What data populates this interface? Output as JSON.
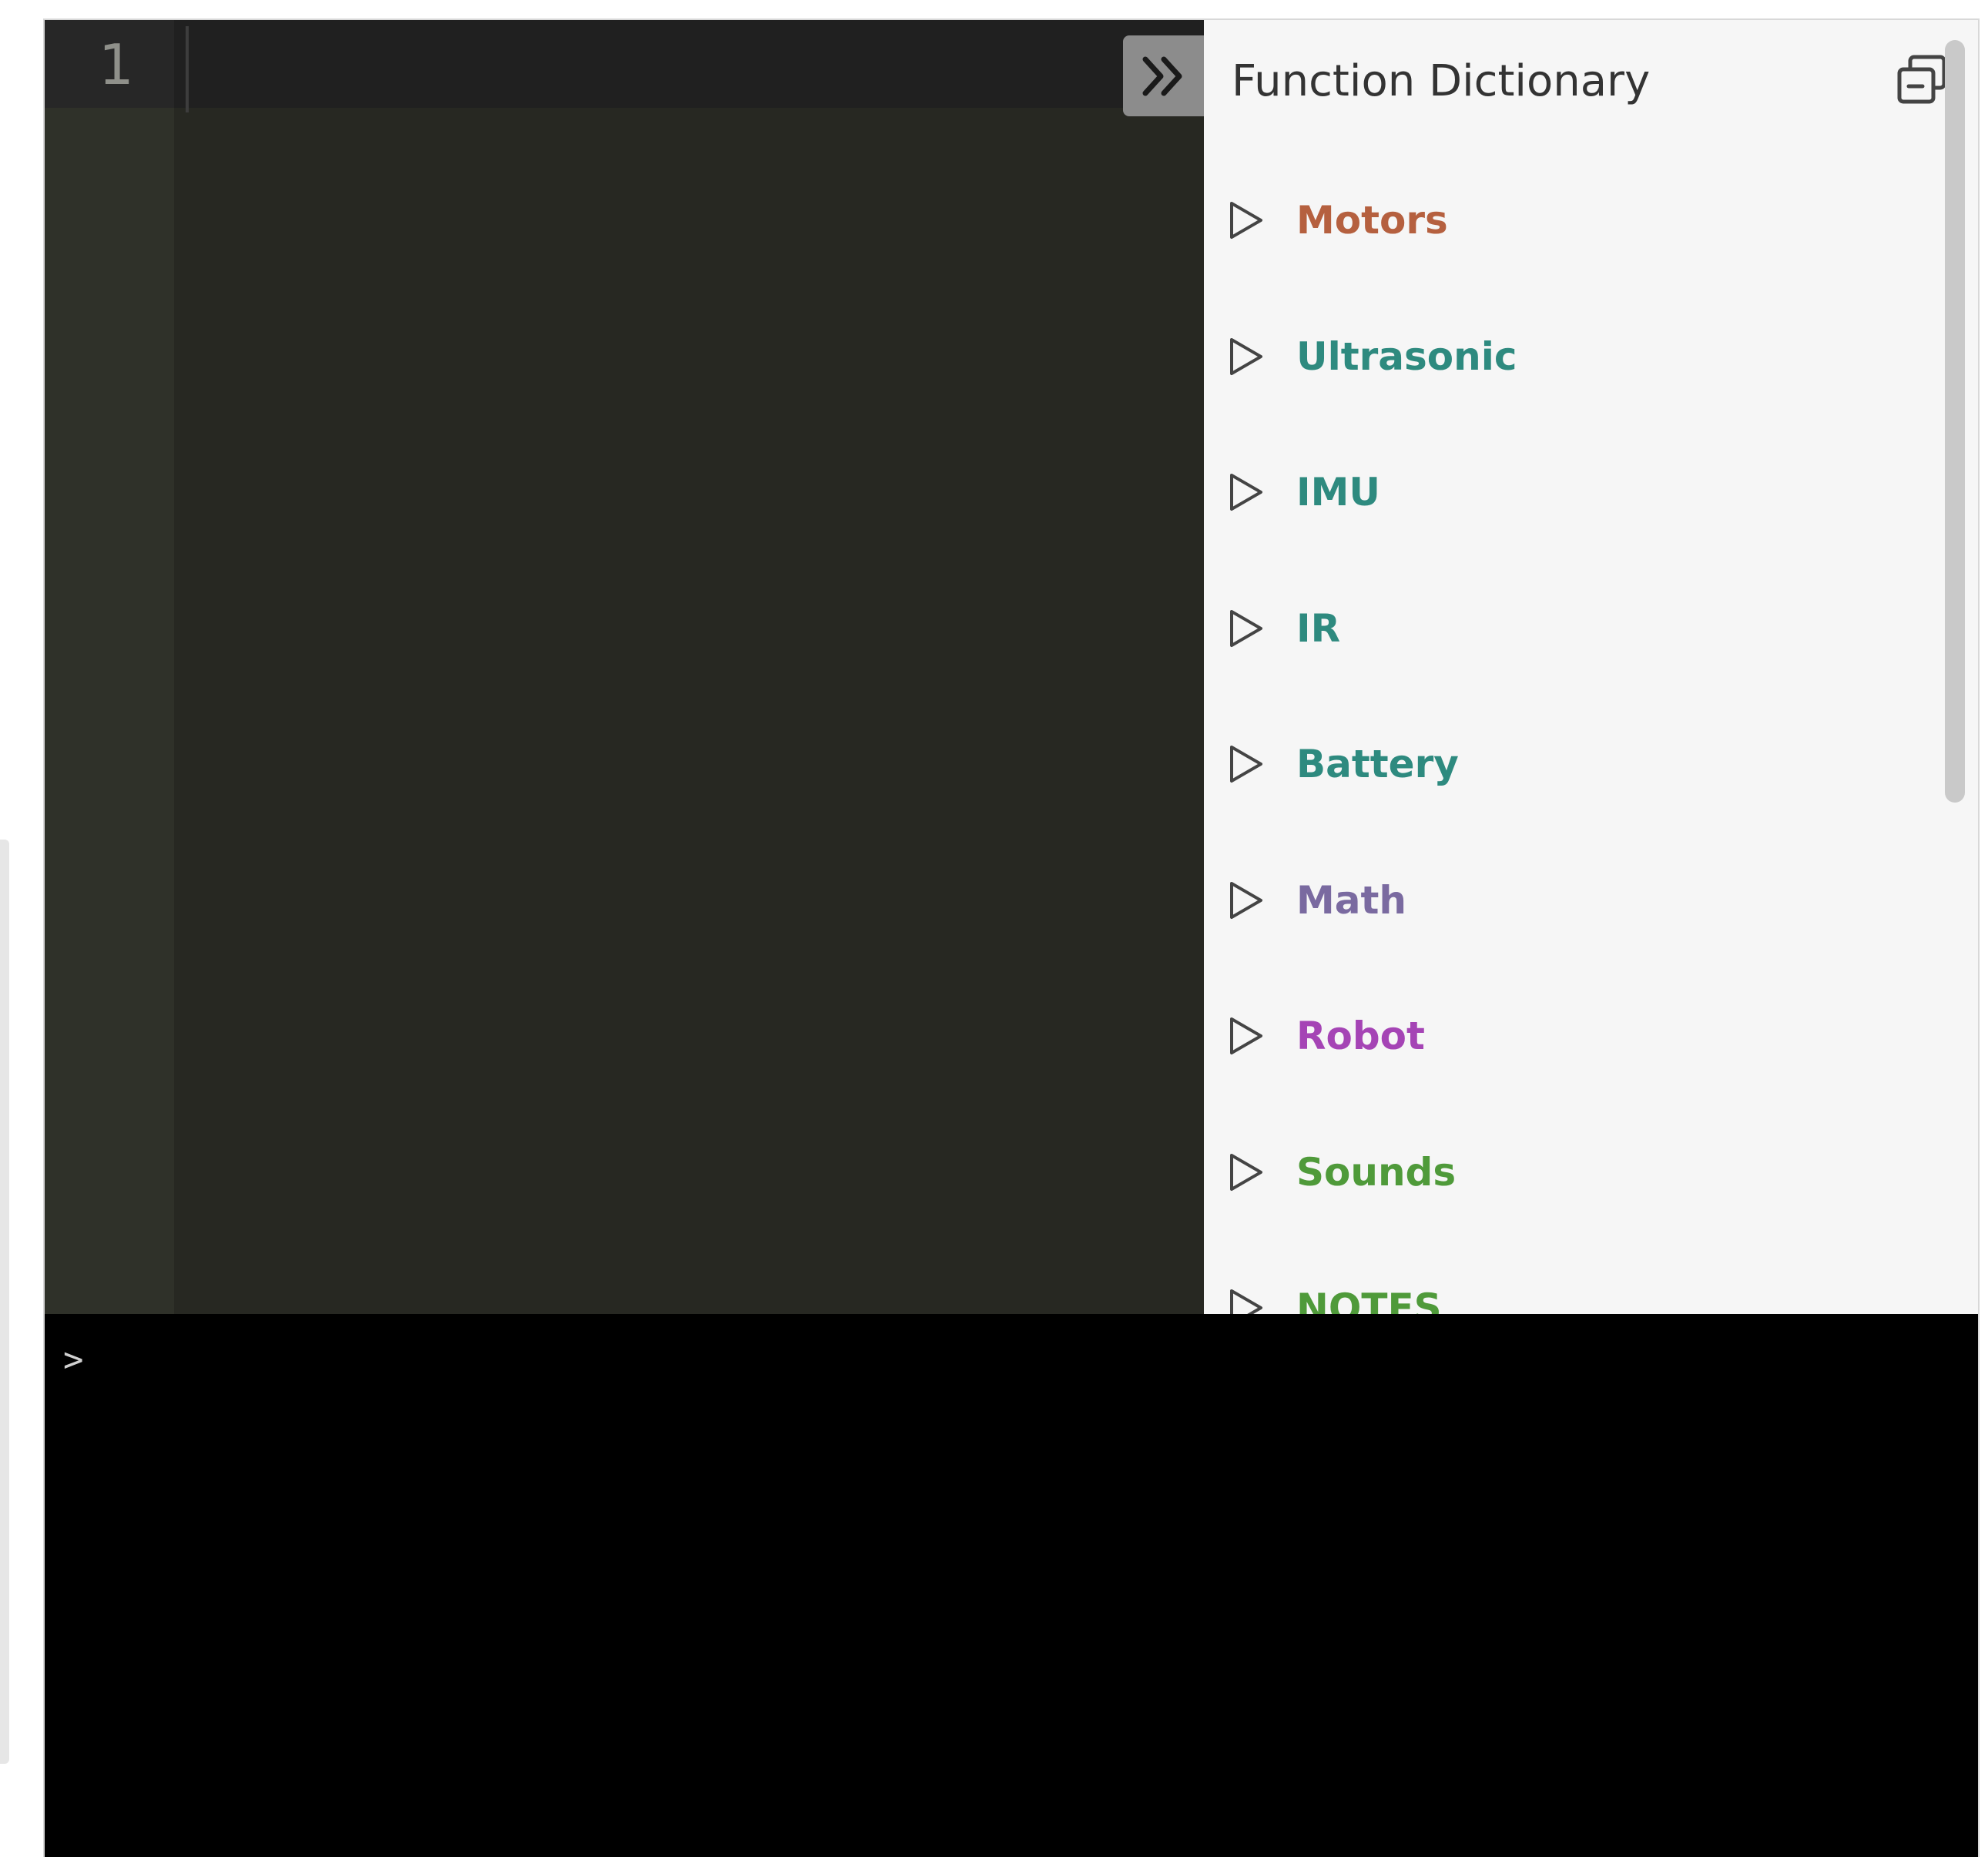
{
  "editor": {
    "line_number": "1"
  },
  "dictionary": {
    "title": "Function Dictionary",
    "items": [
      {
        "label": "Motors",
        "color": "#b5603f"
      },
      {
        "label": "Ultrasonic",
        "color": "#2e8a7f"
      },
      {
        "label": "IMU",
        "color": "#2e8a7f"
      },
      {
        "label": "IR",
        "color": "#2e8a7f"
      },
      {
        "label": "Battery",
        "color": "#2e8a7f"
      },
      {
        "label": "Math",
        "color": "#7a6aa0"
      },
      {
        "label": "Robot",
        "color": "#a544b5"
      },
      {
        "label": "Sounds",
        "color": "#4f9a3a"
      },
      {
        "label": "NOTES",
        "color": "#4f9a3a"
      }
    ]
  },
  "console": {
    "prompt": ">"
  },
  "icons": {
    "collapse": "double-chevron-right-icon",
    "popout": "popout-window-icon",
    "expand": "triangle-right-outline-icon"
  }
}
